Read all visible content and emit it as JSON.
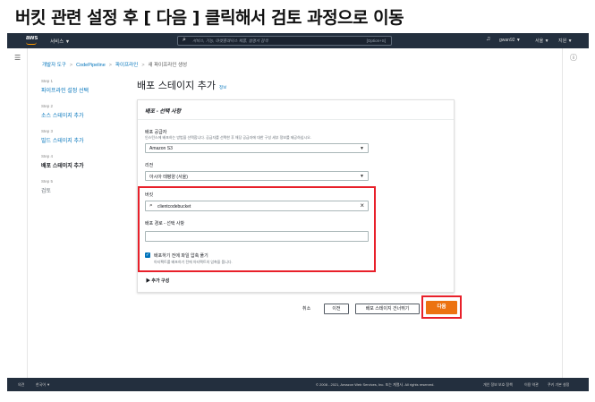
{
  "tutorial_heading": "버킷 관련 설정 후 [ 다음 ] 클릭해서 검토 과정으로 이동",
  "topbar": {
    "logo": "aws",
    "services": "서비스 ▼",
    "search_placeholder": "서비스, 기능, 마켓플레이스 제품, 설명서 검색",
    "search_shortcut": "[Option+S]",
    "user": "gwan92 ▼",
    "region": "서울 ▼",
    "support": "지원 ▼",
    "icons": {
      "search": "search-icon",
      "bell": "bell-icon",
      "menu": "menu-icon",
      "info": "info-icon"
    }
  },
  "breadcrumb": [
    {
      "label": "개발자 도구",
      "link": true
    },
    {
      "label": "CodePipeline",
      "link": true
    },
    {
      "label": "파이프라인",
      "link": true
    },
    {
      "label": "새 파이프라인 생성",
      "link": false
    }
  ],
  "steps": [
    {
      "num": "Step 1",
      "label": "파이프라인 설정 선택",
      "state": "done"
    },
    {
      "num": "Step 2",
      "label": "소스 스테이지 추가",
      "state": "done"
    },
    {
      "num": "Step 3",
      "label": "빌드 스테이지 추가",
      "state": "done"
    },
    {
      "num": "Step 4",
      "label": "배포 스테이지 추가",
      "state": "active"
    },
    {
      "num": "Step 5",
      "label": "검토",
      "state": "pending"
    }
  ],
  "page": {
    "title": "배포 스테이지 추가",
    "info": "정보"
  },
  "panel": {
    "title": "배포 - 선택 사항",
    "provider_label": "배포 공급자",
    "provider_desc": "인스턴스에 배포하는 방법을 선택합니다. 공급자를 선택한 후 해당 공급자에 대한 구성 세부 정보를 제공하십시오.",
    "provider_value": "Amazon S3",
    "region_label": "리전",
    "region_value": "아시아 태평양 (서울)",
    "bucket_label": "버킷",
    "bucket_value": "clientcodebucket",
    "deploy_path_label": "배포 경로 - 선택 사항",
    "deploy_path_value": "",
    "extract_label": "배포하기 전에 파일 압축 풀기",
    "extract_desc": "아티팩트를 배포하기 전에 아티팩트의 압축을 풉니다.",
    "extract_checked": true,
    "advanced": "▶ 추가 구성"
  },
  "actions": {
    "cancel": "취소",
    "previous": "이전",
    "skip": "배포 스테이지 건너뛰기",
    "next": "다음"
  },
  "footer": {
    "feedback": "의견",
    "language": "한국어 ▼",
    "copyright": "© 2008 - 2021, Amazon Web Services, Inc. 또는 계열사. All rights reserved.",
    "privacy": "개인 정보 보호 정책",
    "terms": "이용 약관",
    "cookies": "쿠키 기본 설정"
  },
  "colors": {
    "topbar": "#232f3e",
    "link": "#0073bb",
    "primary": "#ec7211",
    "highlight": "#e8202a"
  }
}
